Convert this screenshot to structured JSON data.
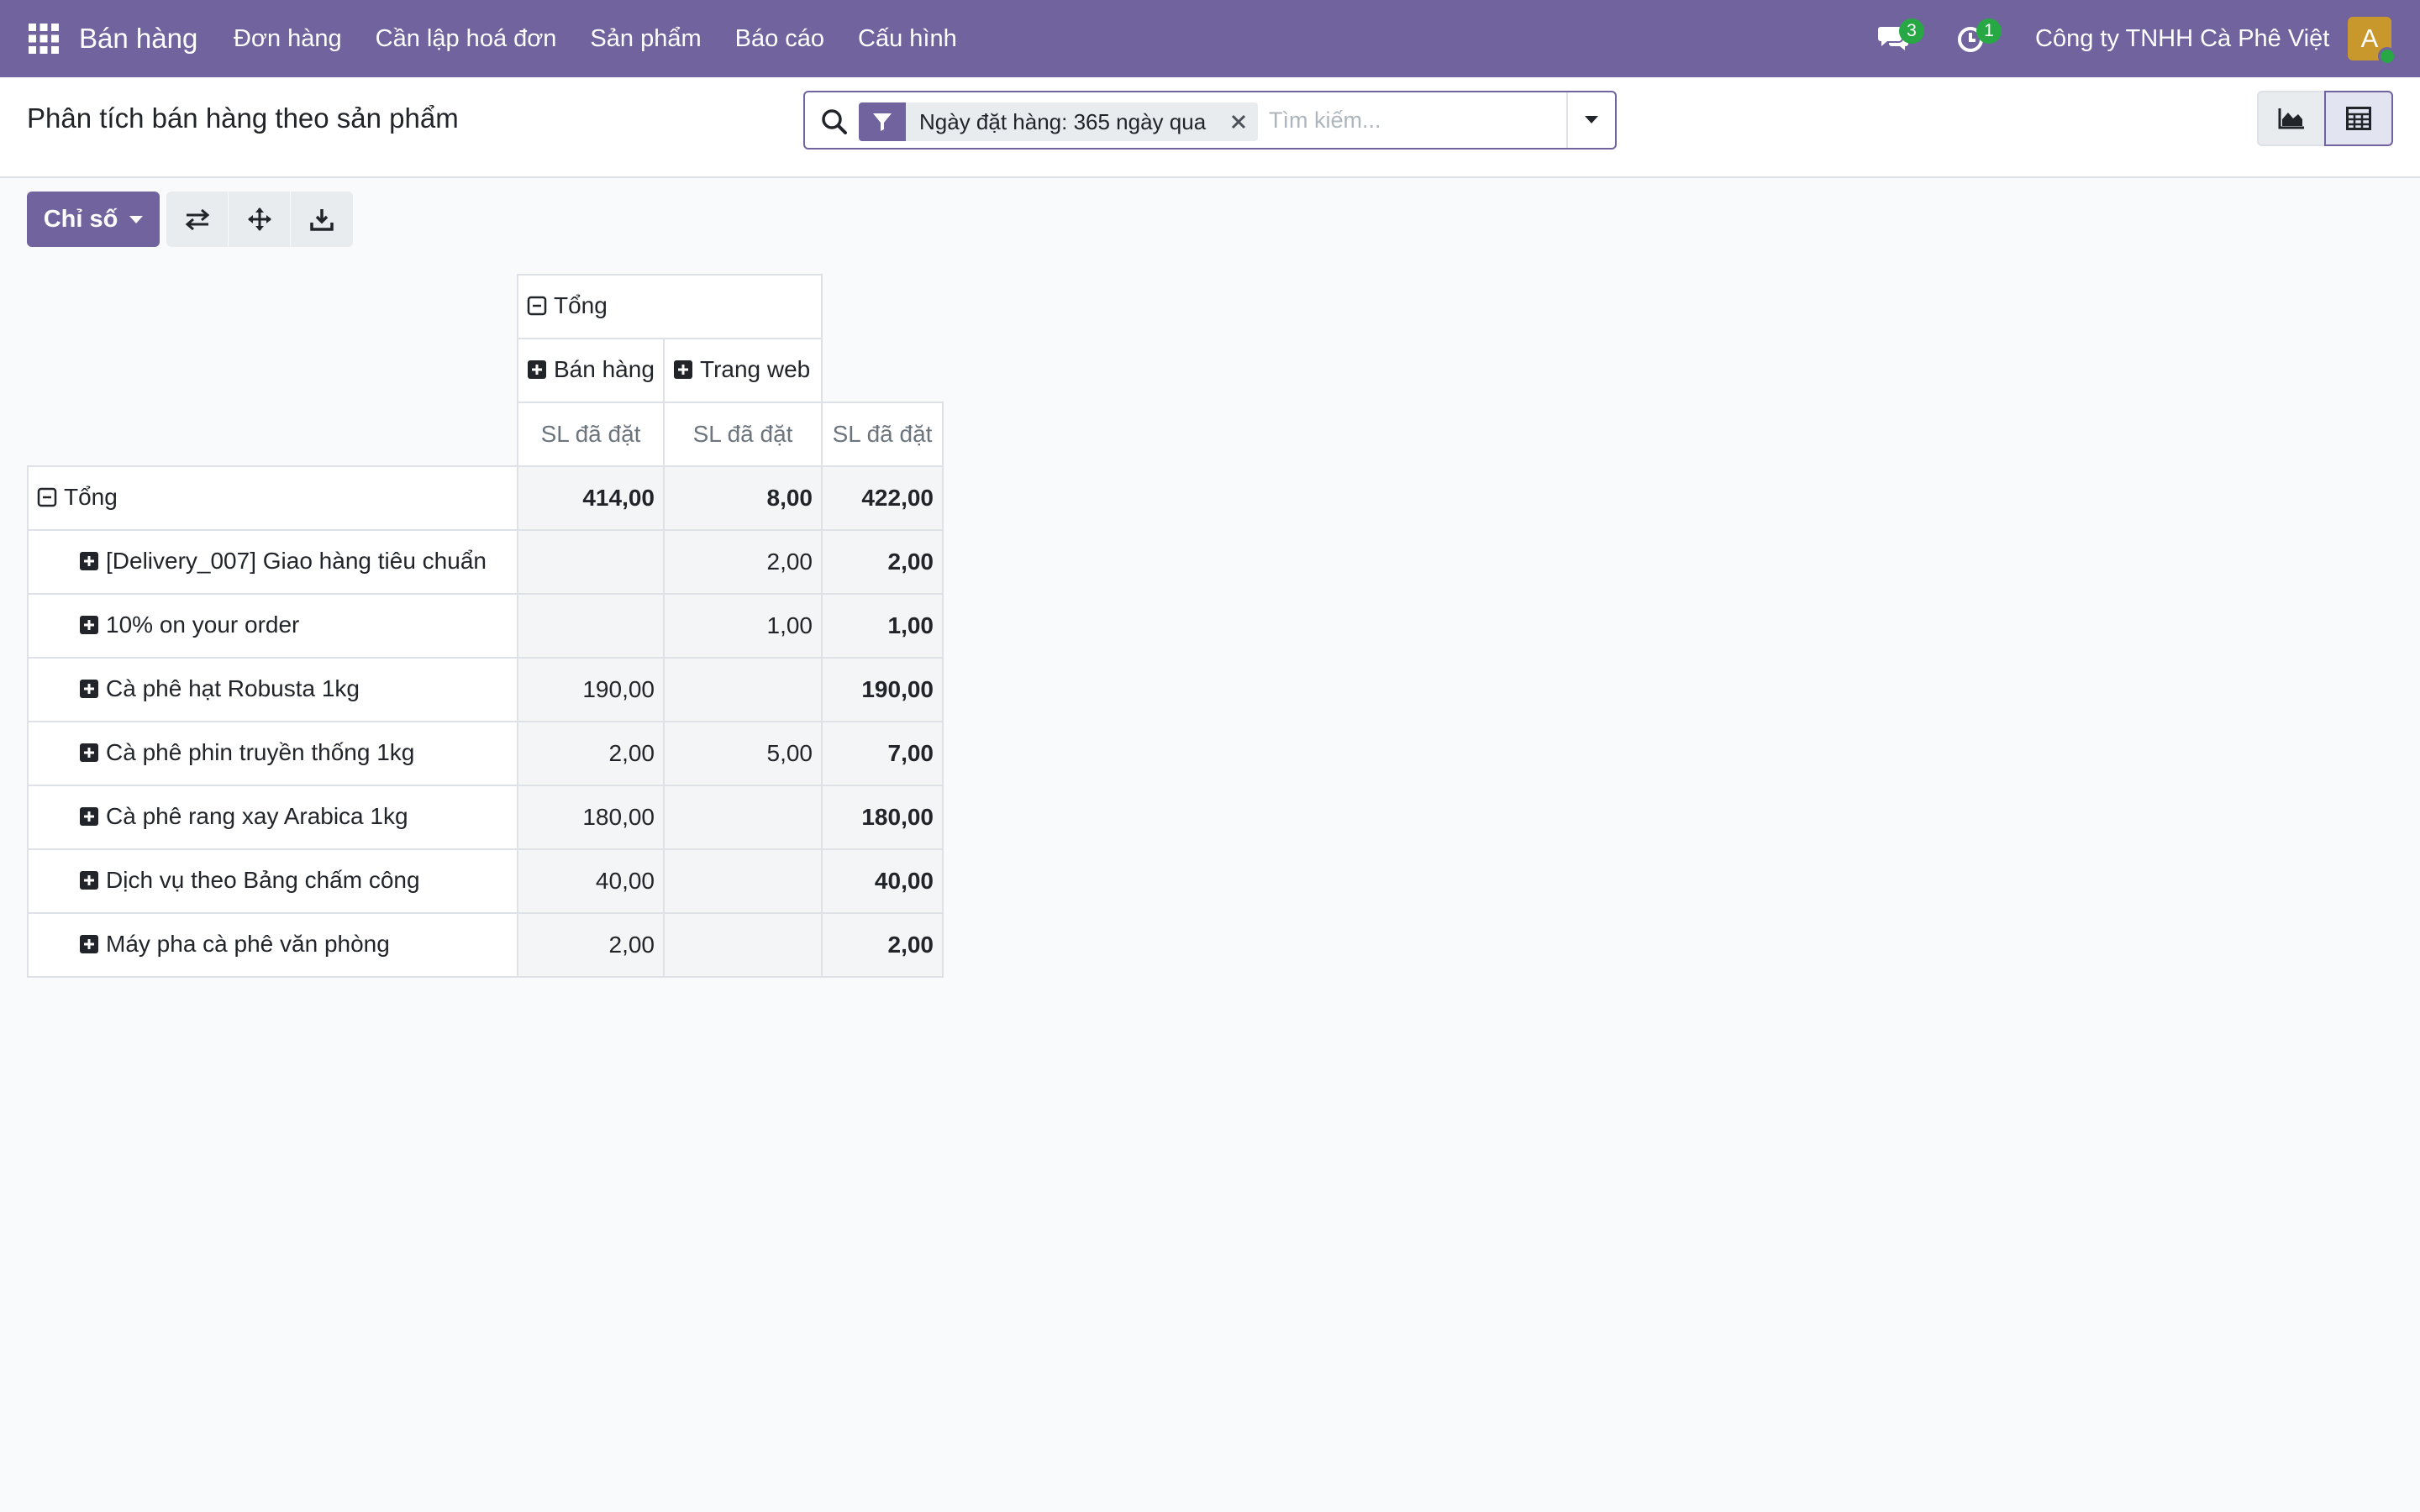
{
  "navbar": {
    "app_name": "Bán hàng",
    "menu": [
      "Đơn hàng",
      "Cần lập hoá đơn",
      "Sản phẩm",
      "Báo cáo",
      "Cấu hình"
    ],
    "messages_count": "3",
    "activities_count": "1",
    "company": "Công ty TNHH Cà Phê Việt",
    "avatar_letter": "A",
    "background": "#71639e"
  },
  "control_panel": {
    "title": "Phân tích bán hàng theo sản phẩm",
    "search": {
      "facet_label": "Ngày đặt hàng: 365 ngày qua",
      "placeholder": "Tìm kiếm..."
    }
  },
  "pivot": {
    "measures_label": "Chỉ số",
    "col_total": "Tổng",
    "col_groups": [
      "Bán hàng",
      "Trang web"
    ],
    "measure_label": "SL đã đặt",
    "row_total": "Tổng",
    "totals": [
      "414,00",
      "8,00",
      "422,00"
    ],
    "rows": [
      {
        "label": "[Delivery_007] Giao hàng tiêu chuẩn",
        "ban_hang": "",
        "trang_web": "2,00",
        "total": "2,00"
      },
      {
        "label": "10% on your order",
        "ban_hang": "",
        "trang_web": "1,00",
        "total": "1,00"
      },
      {
        "label": "Cà phê hạt Robusta 1kg",
        "ban_hang": "190,00",
        "trang_web": "",
        "total": "190,00"
      },
      {
        "label": "Cà phê phin truyền thống 1kg",
        "ban_hang": "2,00",
        "trang_web": "5,00",
        "total": "7,00"
      },
      {
        "label": "Cà phê rang xay Arabica 1kg",
        "ban_hang": "180,00",
        "trang_web": "",
        "total": "180,00"
      },
      {
        "label": "Dịch vụ theo Bảng chấm công",
        "ban_hang": "40,00",
        "trang_web": "",
        "total": "40,00"
      },
      {
        "label": "Máy pha cà phê văn phòng",
        "ban_hang": "2,00",
        "trang_web": "",
        "total": "2,00"
      }
    ]
  },
  "colors": {
    "primary": "#71639e",
    "badge": "#28a745",
    "avatar": "#c8982c"
  }
}
